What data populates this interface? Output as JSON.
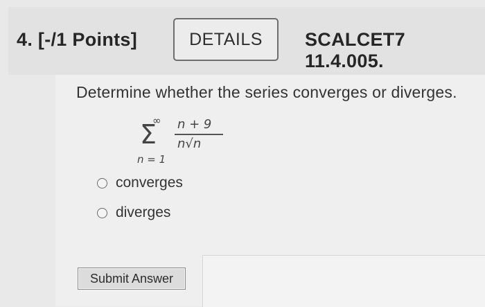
{
  "header": {
    "question_label": "4. [-/1 Points]",
    "details_label": "DETAILS",
    "course_code": "SCALCET7 11.4.005."
  },
  "question": {
    "prompt": "Determine whether the series converges or diverges.",
    "series": {
      "upper_limit": "∞",
      "sigma": "Σ",
      "lower_limit": "n = 1",
      "numerator": "n + 9",
      "denominator": "n√n"
    },
    "options": [
      {
        "label": "converges",
        "selected": false
      },
      {
        "label": "diverges",
        "selected": false
      }
    ]
  },
  "actions": {
    "submit_label": "Submit Answer"
  }
}
